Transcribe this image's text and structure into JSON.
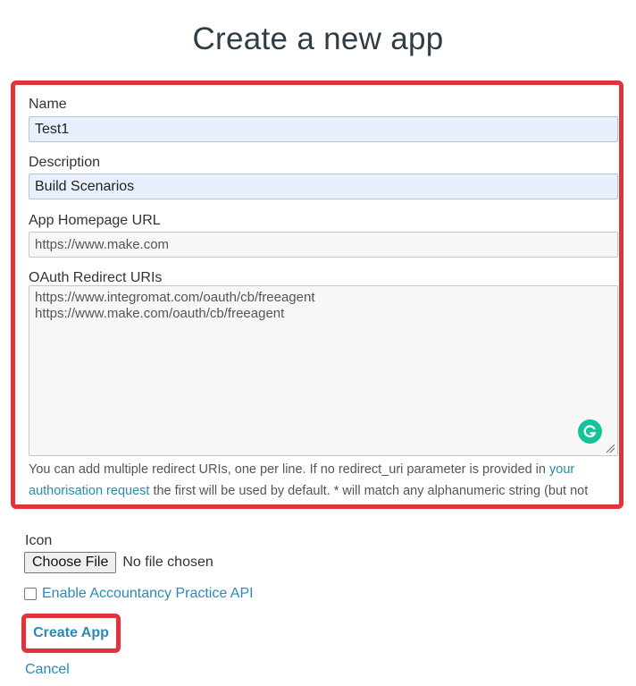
{
  "page": {
    "title": "Create a new app"
  },
  "form": {
    "name_label": "Name",
    "name_value": "Test1",
    "description_label": "Description",
    "description_value": "Build Scenarios",
    "homepage_label": "App Homepage URL",
    "homepage_value": "https://www.make.com",
    "redirect_label": "OAuth Redirect URIs",
    "redirect_value": "https://www.integromat.com/oauth/cb/freeagent\nhttps://www.make.com/oauth/cb/freeagent",
    "help_text_pre": "You can add multiple redirect URIs, one per line. If no redirect_uri parameter is provided in ",
    "help_link": "your authorisation request",
    "help_text_post": " the first will be used by default. * will match any alphanumeric string (but not dots/slashes etc)",
    "icon_label": "Icon",
    "choose_file_label": "Choose File",
    "file_status": "No file chosen",
    "accountancy_label": "Enable Accountancy Practice API",
    "accountancy_checked": false,
    "create_label": "Create App",
    "cancel_label": "Cancel"
  },
  "icons": {
    "grammarly": "grammarly-icon",
    "resize": "resize-grip-icon"
  },
  "colors": {
    "highlight": "#e0343c",
    "link": "#2a8ab3",
    "autofill": "#e8f0fe",
    "grammarly": "#15c39a"
  }
}
